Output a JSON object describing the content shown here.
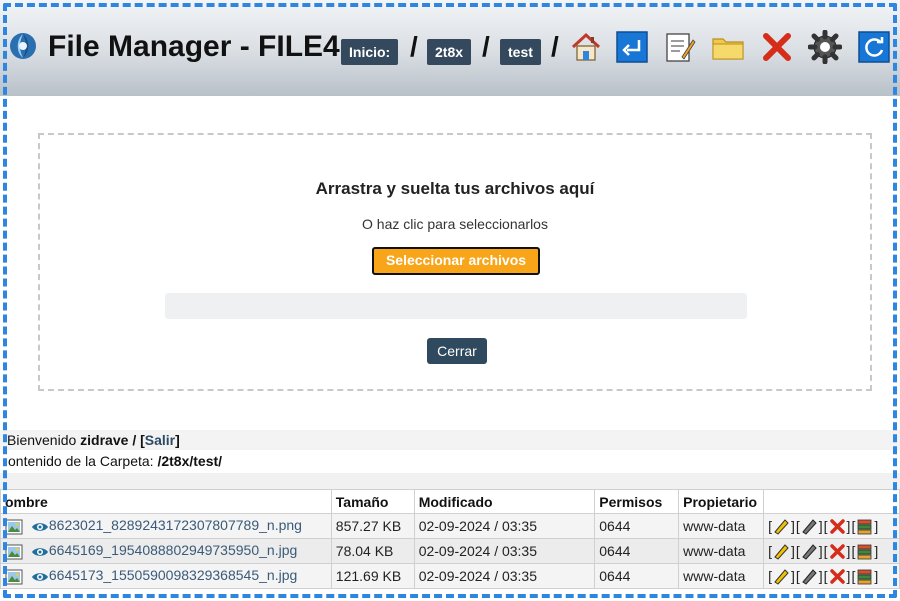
{
  "header": {
    "title": "File Manager - FILE4",
    "breadcrumbs": [
      {
        "label": "Inicio:"
      },
      {
        "label": "2t8x"
      },
      {
        "label": "test"
      }
    ],
    "separator": "/",
    "tools": [
      "home-icon",
      "back-arrow-icon",
      "new-file-icon",
      "new-folder-icon",
      "delete-icon",
      "settings-gear-icon",
      "refresh-icon"
    ]
  },
  "upload": {
    "title": "Arrastra y suelta tus archivos aquí",
    "subtitle": "O haz clic para seleccionarlos",
    "select_button": "Seleccionar archivos",
    "progress": 0,
    "close_button": "Cerrar"
  },
  "session": {
    "welcome_prefix": "Bienvenido",
    "user": "zidrave",
    "separator": "/",
    "logout_open": "[",
    "logout": "Salir",
    "logout_close": "]",
    "folder_label": "ontenido de la Carpeta:",
    "folder_path": "/2t8x/test/"
  },
  "table": {
    "headers": [
      "ombre",
      "Tamaño",
      "Modificado",
      "Permisos",
      "Propietario",
      ""
    ],
    "rows": [
      {
        "name": "8623021_8289243172307807789_n.png",
        "size": "857.27 KB",
        "modified": "02-09-2024 / 03:35",
        "perms": "0644",
        "owner": "www-data"
      },
      {
        "name": "6645169_1954088802949735950_n.jpg",
        "size": "78.04 KB",
        "modified": "02-09-2024 / 03:35",
        "perms": "0644",
        "owner": "www-data"
      },
      {
        "name": "6645173_1550590098329368545_n.jpg",
        "size": "121.69 KB",
        "modified": "02-09-2024 / 03:35",
        "perms": "0644",
        "owner": "www-data"
      }
    ],
    "action_icons": [
      "rename-pencil-icon",
      "edit-pencil-icon",
      "delete-x-icon",
      "download-icon"
    ]
  },
  "colors": {
    "crumb_bg": "#34495e",
    "select_btn": "#f8a51a",
    "close_btn": "#2f4a5f",
    "frame": "#2f86e0",
    "link": "#3a5a78"
  }
}
